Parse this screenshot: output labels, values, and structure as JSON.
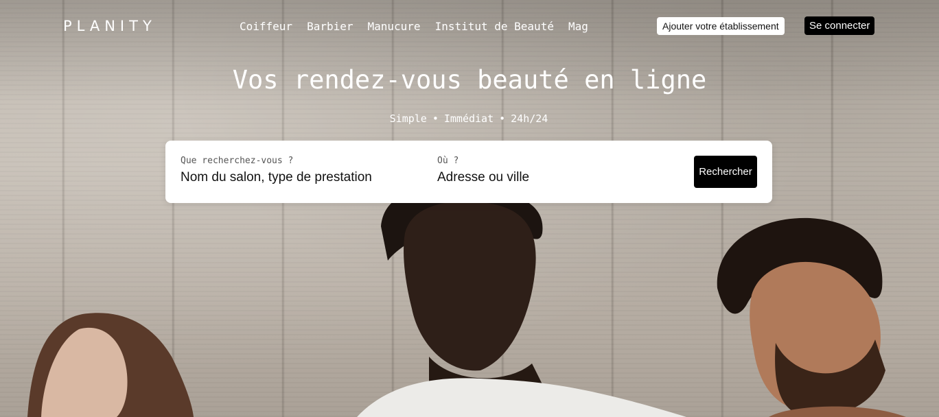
{
  "header": {
    "logo": "PLANITY",
    "nav": [
      "Coiffeur",
      "Barbier",
      "Manucure",
      "Institut de Beauté",
      "Mag"
    ],
    "add_business_label": "Ajouter votre établissement",
    "login_label": "Se connecter"
  },
  "hero": {
    "title": "Vos rendez-vous beauté en ligne",
    "tagline": [
      "Simple",
      "Immédiat",
      "24h/24"
    ],
    "tagline_separator": "•",
    "background_image": "three people photographed from below against a concrete wall"
  },
  "search": {
    "what_label": "Que recherchez-vous ?",
    "what_placeholder": "Nom du salon, type de prestation",
    "where_label": "Où ?",
    "where_placeholder": "Adresse ou ville",
    "submit_label": "Rechercher"
  },
  "colors": {
    "primary_button": "#000000",
    "card_background": "#ffffff",
    "header_text": "#ffffff"
  }
}
